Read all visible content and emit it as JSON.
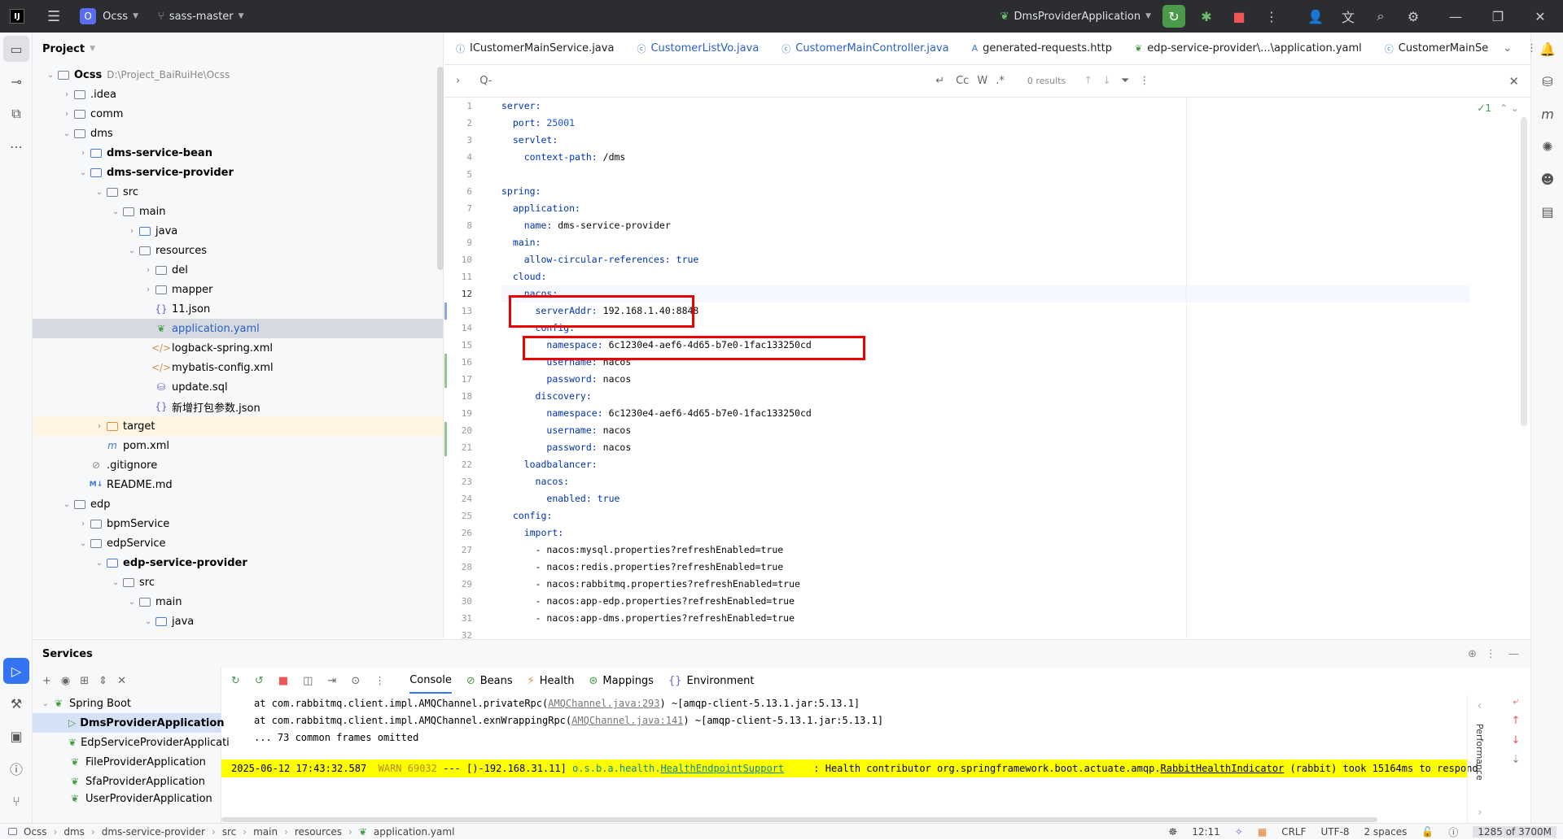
{
  "topbar": {
    "project_badge": "O",
    "project_name": "Ocss",
    "branch": "sass-master",
    "run_config": "DmsProviderApplication"
  },
  "project_panel": {
    "title": "Project",
    "root_name": "Ocss",
    "root_path": "D:\\Project_BaiRuiHe\\Ocss",
    "items": [
      {
        "label": "Ocss"
      },
      {
        "label": ".idea"
      },
      {
        "label": "comm"
      },
      {
        "label": "dms"
      },
      {
        "label": "dms-service-bean"
      },
      {
        "label": "dms-service-provider"
      },
      {
        "label": "src"
      },
      {
        "label": "main"
      },
      {
        "label": "java"
      },
      {
        "label": "resources"
      },
      {
        "label": "del"
      },
      {
        "label": "mapper"
      },
      {
        "label": "11.json"
      },
      {
        "label": "application.yaml"
      },
      {
        "label": "logback-spring.xml"
      },
      {
        "label": "mybatis-config.xml"
      },
      {
        "label": "update.sql"
      },
      {
        "label": "新增打包参数.json"
      },
      {
        "label": "target"
      },
      {
        "label": "pom.xml"
      },
      {
        "label": ".gitignore"
      },
      {
        "label": "README.md"
      },
      {
        "label": "edp"
      },
      {
        "label": "bpmService"
      },
      {
        "label": "edpService"
      },
      {
        "label": "edp-service-provider"
      },
      {
        "label": "src"
      },
      {
        "label": "main"
      },
      {
        "label": "java"
      }
    ]
  },
  "editor": {
    "tabs": [
      {
        "label": "ICustomerMainService.java"
      },
      {
        "label": "CustomerListVo.java"
      },
      {
        "label": "CustomerMainController.java"
      },
      {
        "label": "generated-requests.http"
      },
      {
        "label": "edp-service-provider\\...\\application.yaml"
      },
      {
        "label": "CustomerMainSe"
      }
    ],
    "search": {
      "placeholder": "Q-",
      "results": "0 results",
      "cc": "Cc",
      "w": "W",
      "regex": ".*"
    },
    "inspection": "1",
    "lines": [
      {
        "n": "1"
      },
      {
        "n": "2"
      },
      {
        "n": "3"
      },
      {
        "n": "4"
      },
      {
        "n": "5"
      },
      {
        "n": "6"
      },
      {
        "n": "7"
      },
      {
        "n": "8"
      },
      {
        "n": "9"
      },
      {
        "n": "10"
      },
      {
        "n": "11"
      },
      {
        "n": "12"
      },
      {
        "n": "13"
      },
      {
        "n": "14"
      },
      {
        "n": "15"
      },
      {
        "n": "16"
      },
      {
        "n": "17"
      },
      {
        "n": "18"
      },
      {
        "n": "19"
      },
      {
        "n": "20"
      },
      {
        "n": "21"
      },
      {
        "n": "22"
      },
      {
        "n": "23"
      },
      {
        "n": "24"
      },
      {
        "n": "25"
      },
      {
        "n": "26"
      },
      {
        "n": "27"
      },
      {
        "n": "28"
      },
      {
        "n": "29"
      },
      {
        "n": "30"
      },
      {
        "n": "31"
      },
      {
        "n": "32"
      }
    ],
    "code": {
      "l1k": "server:",
      "l2k": "port:",
      "l2v": "25001",
      "l3k": "servlet:",
      "l4k": "context-path:",
      "l4v": "/dms",
      "l6k": "spring:",
      "l7k": "application:",
      "l8k": "name:",
      "l8v": "dms-service-provider",
      "l9k": "main:",
      "l10k": "allow-circular-references:",
      "l10v": "true",
      "l11k": "cloud:",
      "l12k": "nacos:",
      "l13k": "serverAddr:",
      "l13v": "192.168.1.40:8848",
      "l14k": "config:",
      "l15k": "namespace:",
      "l15v": "6c1230e4-aef6-4d65-b7e0-1fac133250cd",
      "l16k": "username:",
      "l16v": "nacos",
      "l17k": "password:",
      "l17v": "nacos",
      "l18k": "discovery:",
      "l19k": "namespace:",
      "l19v": "6c1230e4-aef6-4d65-b7e0-1fac133250cd",
      "l20k": "username:",
      "l20v": "nacos",
      "l21k": "password:",
      "l21v": "nacos",
      "l22k": "loadbalancer:",
      "l23k": "nacos:",
      "l24k": "enabled:",
      "l24v": "true",
      "l25k": "config:",
      "l26k": "import:",
      "l27v": "- nacos:mysql.properties?refreshEnabled=true",
      "l28v": "- nacos:redis.properties?refreshEnabled=true",
      "l29v": "- nacos:rabbitmq.properties?refreshEnabled=true",
      "l30v": "- nacos:app-edp.properties?refreshEnabled=true",
      "l31v": "- nacos:app-dms.properties?refreshEnabled=true"
    }
  },
  "services": {
    "title": "Services",
    "tree": [
      {
        "label": "Spring Boot"
      },
      {
        "label": "DmsProviderApplication"
      },
      {
        "label": "EdpServiceProviderApplicati"
      },
      {
        "label": "FileProviderApplication"
      },
      {
        "label": "SfaProviderApplication"
      },
      {
        "label": "UserProviderApplication"
      }
    ],
    "console_tabs": [
      {
        "label": "Console"
      },
      {
        "label": "Beans"
      },
      {
        "label": "Health"
      },
      {
        "label": "Mappings"
      },
      {
        "label": "Environment"
      }
    ],
    "console_lines": {
      "l1a": "at com.rabbitmq.client.impl.AMQChannel.privateRpc(",
      "l1link": "AMQChannel.java:293",
      "l1b": ") ~[amqp-client-5.13.1.jar:5.13.1]",
      "l2a": "at com.rabbitmq.client.impl.AMQChannel.exnWrappingRpc(",
      "l2link": "AMQChannel.java:141",
      "l2b": ") ~[amqp-client-5.13.1.jar:5.13.1]",
      "l3": "... 73 common frames omitted",
      "warn_ts": "2025-06-12 17:43:32.587",
      "warn_level": "WARN 69032",
      "warn_sep": "--- [)-192.168.31.11]",
      "warn_logger_a": "o.s.b.a.health.",
      "warn_logger_link": "HealthEndpointSupport",
      "warn_msg_a": ": Health contributor org.springframework.boot.actuate.amqp.",
      "warn_msg_link": "RabbitHealthIndicator",
      "warn_msg_b": "(rabbit) took 15164ms to respond"
    },
    "performance_label": "Performance"
  },
  "statusbar": {
    "breadcrumbs": [
      "Ocss",
      "dms",
      "dms-service-provider",
      "src",
      "main",
      "resources",
      "application.yaml"
    ],
    "time": "12:11",
    "line_sep": "CRLF",
    "encoding": "UTF-8",
    "indent": "2 spaces",
    "memory": "1285 of 3700M"
  }
}
